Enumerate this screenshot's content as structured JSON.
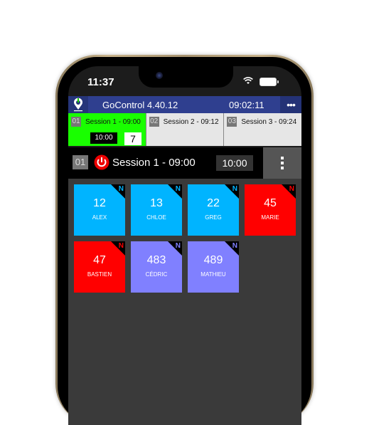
{
  "status_bar": {
    "time": "11:37",
    "wifi_icon": "wifi-icon",
    "battery_icon": "battery-icon"
  },
  "app_header": {
    "logo_icon": "location-power-icon",
    "title": "GoControl 4.40.12",
    "clock": "09:02:11",
    "more_label": "•••"
  },
  "session_tabs": [
    {
      "num": "01",
      "label": "Session 1 - 09:00",
      "timer": "10:00",
      "count": "7",
      "active": true
    },
    {
      "num": "02",
      "label": "Session 2 - 09:12",
      "active": false
    },
    {
      "num": "03",
      "label": "Session 3 - 09:24",
      "active": false
    }
  ],
  "current_session": {
    "num": "01",
    "title": "Session 1 - 09:00",
    "timer": "10:00",
    "power_icon": "power-icon",
    "menu_icon": "kebab-menu-icon"
  },
  "colors": {
    "blue_tile": "#00b4ff",
    "red_tile": "#ff0000",
    "purple_tile": "#8080ff",
    "active_tab": "#19ff00",
    "header": "#2f3f8f"
  },
  "participants": [
    {
      "number": "12",
      "name": "ALEX",
      "badge": "N",
      "color": "blue"
    },
    {
      "number": "13",
      "name": "CHLOE",
      "badge": "N",
      "color": "blue"
    },
    {
      "number": "22",
      "name": "GREG",
      "badge": "N",
      "color": "blue"
    },
    {
      "number": "45",
      "name": "MARIE",
      "badge": "N",
      "color": "red"
    },
    {
      "number": "47",
      "name": "BASTIEN",
      "badge": "N",
      "color": "red"
    },
    {
      "number": "483",
      "name": "CÉDRIC",
      "badge": "N",
      "color": "purple"
    },
    {
      "number": "489",
      "name": "MATHIEU",
      "badge": "N",
      "color": "purple"
    }
  ]
}
